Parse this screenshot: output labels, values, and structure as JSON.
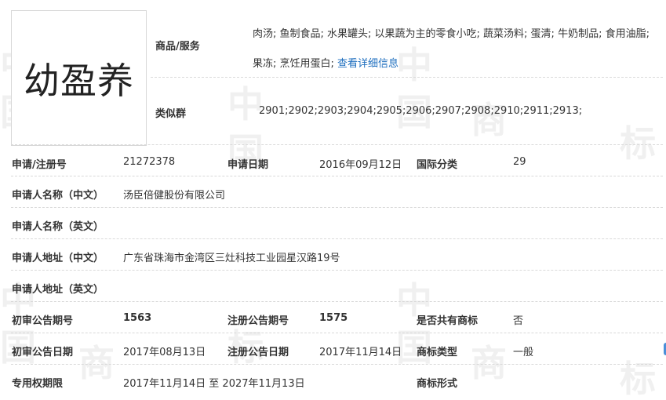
{
  "watermark_char": "商标",
  "logo": {
    "text": "幼盈养"
  },
  "goods": {
    "label": "商品/服务",
    "text": "肉汤; 鱼制食品; 水果罐头; 以果蔬为主的零食小吃; 蔬菜汤料; 蛋清; 牛奶制品; 食用油脂; 果冻; 烹饪用蛋白;",
    "link": "查看详细信息"
  },
  "similar_group": {
    "label": "类似群",
    "value": "2901;2902;2903;2904;2905;2906;2907;2908;2910;2911;2913;"
  },
  "rows": {
    "reg_no_label": "申请/注册号",
    "reg_no": "21272378",
    "app_date_label": "申请日期",
    "app_date": "2016年09月12日",
    "intl_class_label": "国际分类",
    "intl_class": "29",
    "applicant_cn_label": "申请人名称（中文）",
    "applicant_cn": "汤臣倍健股份有限公司",
    "applicant_en_label": "申请人名称（英文）",
    "address_cn_label": "申请人地址（中文）",
    "address_cn": "广东省珠海市金湾区三灶科技工业园星汉路19号",
    "address_en_label": "申请人地址（英文）",
    "prelim_issue_label": "初审公告期号",
    "prelim_issue": "1563",
    "reg_issue_label": "注册公告期号",
    "reg_issue": "1575",
    "shared_label": "是否共有商标",
    "shared": "否",
    "prelim_date_label": "初审公告日期",
    "prelim_date": "2017年08月13日",
    "reg_date_label": "注册公告日期",
    "reg_date": "2017年11月14日",
    "tm_type_label": "商标类型",
    "tm_type": "一般",
    "exclusive_label": "专用权期限",
    "exclusive": "2017年11月14日 至 2027年11月13日",
    "tm_form_label": "商标形式"
  }
}
